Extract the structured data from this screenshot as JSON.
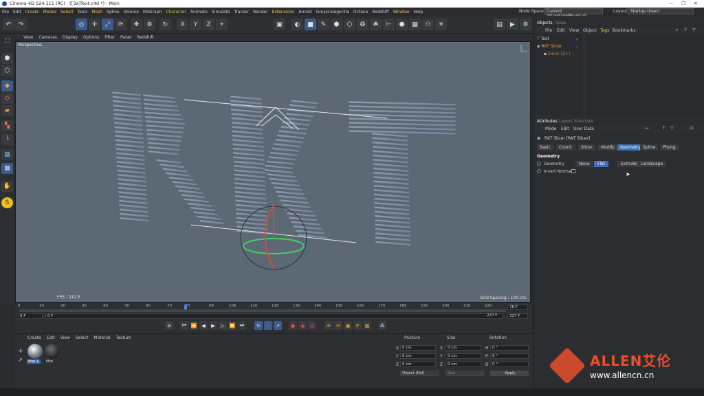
{
  "window": {
    "title": "Cinema 4D S24.111 (RC) - [[3a]Text.c4d *] - Main",
    "controls": [
      "—",
      "❐",
      "✕"
    ]
  },
  "menubar": {
    "items": [
      "File",
      "Edit",
      "Create",
      "Modes",
      "Select",
      "Tools",
      "Mesh",
      "Spline",
      "Volume",
      "MoGraph",
      "Character",
      "Animate",
      "Simulate",
      "Tracker",
      "Render",
      "Extensions",
      "Arnold",
      "Greyscalegorilla",
      "Octane",
      "Redshift",
      "Window",
      "Help"
    ],
    "node_space_label": "Node Space:",
    "node_space_value": "Current (Standard/Physical)",
    "layout_label": "Layout:",
    "layout_value": "Startup (User)"
  },
  "viewport_menu": [
    "View",
    "Cameras",
    "Display",
    "Options",
    "Filter",
    "Panel",
    "Redshift"
  ],
  "viewport": {
    "label": "Perspective",
    "fps": "FPS : 312.5",
    "grid_spacing": "Grid Spacing : 100 cm",
    "background": "#5d6875",
    "text_3d": "RKT"
  },
  "timeline": {
    "ticks": [
      "0",
      "10",
      "20",
      "30",
      "40",
      "50",
      "60",
      "70",
      "75",
      "90",
      "100",
      "110",
      "120",
      "130",
      "140",
      "150",
      "160",
      "170",
      "180",
      "190",
      "200",
      "210",
      "220"
    ],
    "current_frame": "75",
    "end_frame": "227 F",
    "field_right_top": "78 F",
    "field_left": "0 F",
    "field_left2": "0 F",
    "field_right_a": "227 F",
    "field_right_b": "227 F"
  },
  "material_panel": {
    "menu": [
      "Create",
      "Edit",
      "View",
      "Select",
      "Material",
      "Texture"
    ],
    "materials": [
      {
        "name": "Mat.1"
      },
      {
        "name": "Mat"
      }
    ]
  },
  "coord_panel": {
    "headers": [
      "Position",
      "Size",
      "Rotation"
    ],
    "rows": [
      {
        "axis": "X",
        "pos": "0 cm",
        "size": "0 cm",
        "rot_axis": "H",
        "rot": "0 °"
      },
      {
        "axis": "Y",
        "pos": "0 cm",
        "size": "0 cm",
        "rot_axis": "P",
        "rot": "0 °"
      },
      {
        "axis": "Z",
        "pos": "0 cm",
        "size": "0 cm",
        "rot_axis": "B",
        "rot": "0 °"
      }
    ],
    "mode_select": "Object (Rel)",
    "size_select": "Size",
    "apply_label": "Apply"
  },
  "objects_panel": {
    "tabs": [
      "Objects",
      "Takes"
    ],
    "menu": [
      "File",
      "Edit",
      "View",
      "Object",
      "Tags",
      "Bookmarks"
    ],
    "objects": [
      {
        "name": "Text",
        "color": "#d0d0d0"
      },
      {
        "name": "RKT Slicer",
        "color": "#f0a030"
      },
      {
        "name": "Slicer (Z+)",
        "color": "#c8883a"
      }
    ]
  },
  "attributes_panel": {
    "tabs": [
      "Attributes",
      "Layers",
      "Structure"
    ],
    "menu": [
      "Mode",
      "Edit",
      "User Data"
    ],
    "object_title": "RKT Slicer [RKT Slicer]",
    "subtabs": [
      "Basic",
      "Coord.",
      "Slicer",
      "Modify",
      "Geometry",
      "Spline",
      "Phong"
    ],
    "selected_subtab": "Geometry",
    "section_title": "Geometry",
    "geometry_label": "Geometry",
    "geometry_modes": [
      "None",
      "Flat",
      "Extruded",
      "Landscape"
    ],
    "selected_mode": "Flat",
    "invert_normals_label": "Invert Normals"
  },
  "watermark": {
    "brand": "ALLEN艾伦",
    "url": "www.allencn.cn",
    "accent": "#e8502c"
  }
}
